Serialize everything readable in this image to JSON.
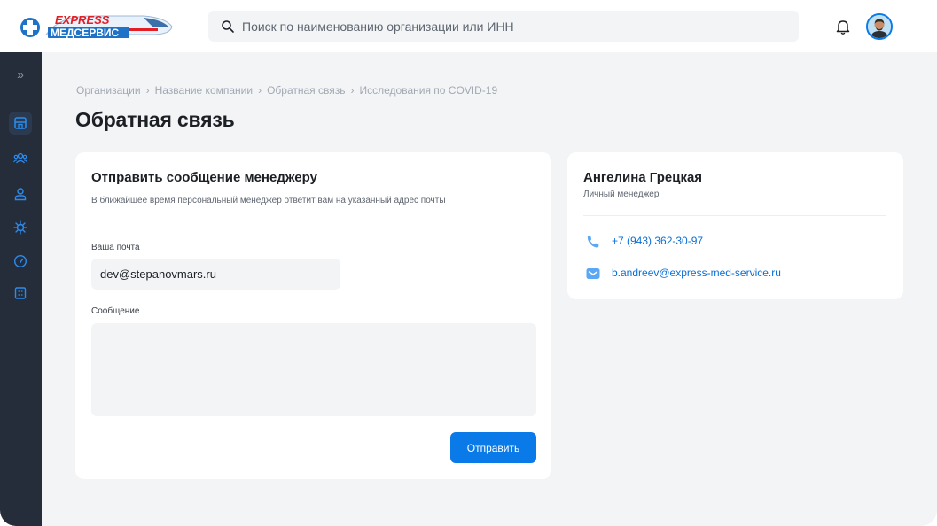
{
  "header": {
    "logo_top": "EXPRESS",
    "logo_bottom": "МЕДСЕРВИС",
    "search_placeholder": "Поиск по наименованию организации или ИНН",
    "search_value": ""
  },
  "sidebar": {
    "expand_glyph": "»",
    "items": [
      {
        "icon": "organization-icon",
        "active": true
      },
      {
        "icon": "users-icon",
        "active": false
      },
      {
        "icon": "user-icon",
        "active": false
      },
      {
        "icon": "virus-icon",
        "active": false
      },
      {
        "icon": "gauge-icon",
        "active": false
      },
      {
        "icon": "document-icon",
        "active": false
      }
    ]
  },
  "breadcrumb": [
    "Организации",
    "Название компании",
    "Обратная связь",
    "Исследования по COVID-19"
  ],
  "breadcrumb_separator": "›",
  "page_title": "Обратная связь",
  "form": {
    "title": "Отправить сообщение менеджеру",
    "subtitle": "В ближайшее время персональный менеджер ответит вам на указанный адрес почты",
    "email_label": "Ваша почта",
    "email_value": "dev@stepanovmars.ru",
    "message_label": "Сообщение",
    "message_value": "",
    "submit_label": "Отправить"
  },
  "manager": {
    "name": "Ангелина Грецкая",
    "role": "Личный менеджер",
    "phone": "+7 (943) 362-30-97",
    "email": "b.andreev@express-med-service.ru"
  },
  "colors": {
    "accent": "#0a7ae8",
    "sidebar_bg": "#262d3a",
    "page_bg": "#f2f4f6",
    "logo_red": "#e31e24"
  }
}
